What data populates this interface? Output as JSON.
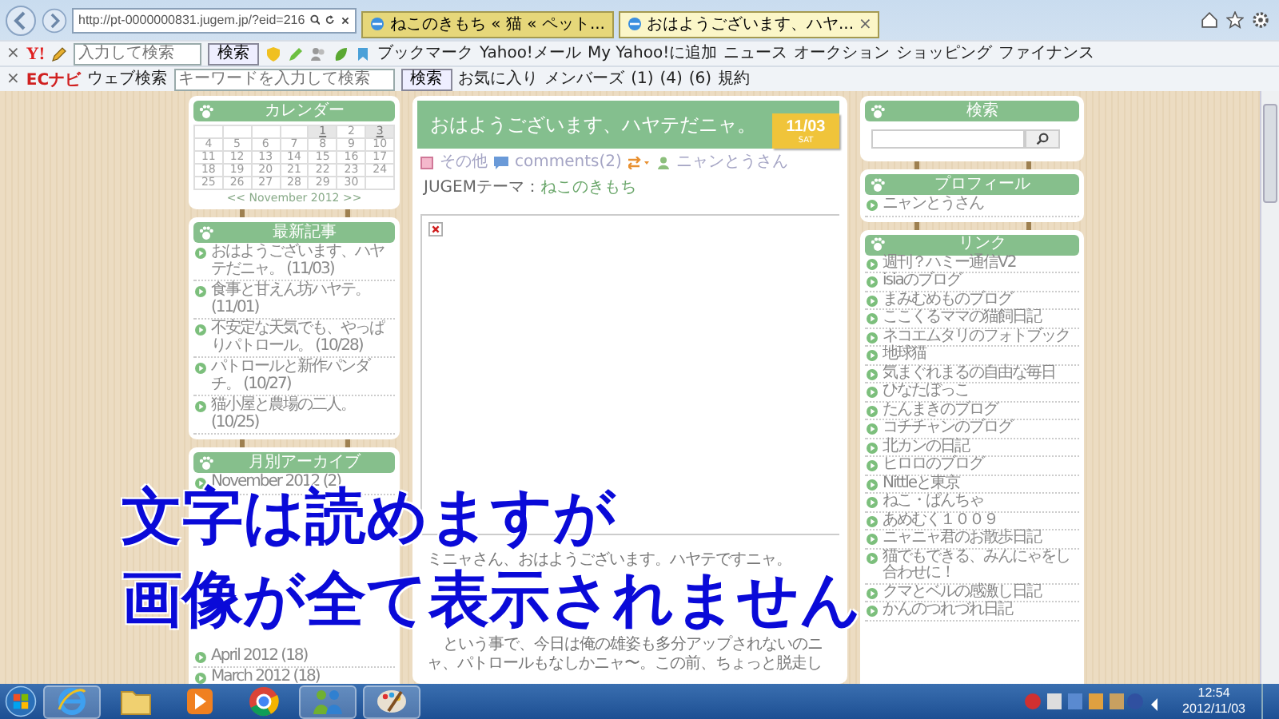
{
  "browser": {
    "address": "http://pt-0000000831.jugem.jp/?eid=216",
    "tab_close": "×",
    "tabs": [
      {
        "label": "ねこのきもち « 猫 « ペット...",
        "selected": false
      },
      {
        "label": "おはようございます、ハヤ...",
        "selected": true
      }
    ]
  },
  "toolbar_1": {
    "close": "×",
    "logo": "Y!",
    "search_placeholder": "入力して検索",
    "search_button": "検索",
    "items": [
      "ブックマーク",
      "Yahoo!メール",
      "My Yahoo!に追加",
      "ニュース",
      "オークション",
      "ショッピング",
      "ファイナンス"
    ]
  },
  "toolbar_2": {
    "close": "×",
    "logo": "ECナビ",
    "web_search": "ウェブ検索",
    "search_placeholder": "キーワードを入力して検索",
    "search_button": "検索",
    "items": [
      "お気に入り",
      "メンバーズ"
    ],
    "counts": [
      "(1)",
      "(4)",
      "(6)"
    ],
    "terms": "規約"
  },
  "calendar": {
    "title": "カレンダー",
    "nav": "<< November 2012 >>",
    "weeks": [
      [
        {
          "day": "1",
          "has_post": true
        },
        {
          "day": "2",
          "has_post": false
        },
        {
          "day": "3",
          "has_post": true
        }
      ],
      [
        {
          "day": "4",
          "has_post": false
        },
        {
          "day": "5",
          "has_post": false
        },
        {
          "day": "6",
          "has_post": false
        },
        {
          "day": "7",
          "has_post": false
        },
        {
          "day": "8",
          "has_post": false
        },
        {
          "day": "9",
          "has_post": false
        },
        {
          "day": "10",
          "has_post": false
        }
      ],
      [
        {
          "day": "11",
          "has_post": false
        },
        {
          "day": "12",
          "has_post": false
        },
        {
          "day": "13",
          "has_post": false
        },
        {
          "day": "14",
          "has_post": false
        },
        {
          "day": "15",
          "has_post": false
        },
        {
          "day": "16",
          "has_post": false
        },
        {
          "day": "17",
          "has_post": false
        }
      ],
      [
        {
          "day": "18",
          "has_post": false
        },
        {
          "day": "19",
          "has_post": false
        },
        {
          "day": "20",
          "has_post": false
        },
        {
          "day": "21",
          "has_post": false
        },
        {
          "day": "22",
          "has_post": false
        },
        {
          "day": "23",
          "has_post": false
        },
        {
          "day": "24",
          "has_post": false
        }
      ],
      [
        {
          "day": "25",
          "has_post": false
        },
        {
          "day": "26",
          "has_post": false
        },
        {
          "day": "27",
          "has_post": false
        },
        {
          "day": "28",
          "has_post": false
        },
        {
          "day": "29",
          "has_post": false
        },
        {
          "day": "30",
          "has_post": false
        }
      ]
    ]
  },
  "recent": {
    "title": "最新記事",
    "items": [
      {
        "title": "おはようございます、ハヤテだニャ。",
        "date": "(11/03)"
      },
      {
        "title": "食事と甘えん坊ハヤテ。",
        "date": "(11/01)"
      },
      {
        "title": "不安定な天気でも、やっぱりパトロール。",
        "date": "(10/28)"
      },
      {
        "title": "パトロールと新作パンダチ。",
        "date": "(10/27)"
      },
      {
        "title": "猫小屋と農場の二人。",
        "date": "(10/25)"
      }
    ]
  },
  "archive": {
    "title": "月別アーカイブ",
    "items": [
      "November 2012 (2)",
      "April 2012 (18)",
      "March 2012 (18)"
    ]
  },
  "post": {
    "title": "おはようございます、ハヤテだニャ。",
    "date": "11/03",
    "weekday": "SAT",
    "category": "その他",
    "comments": "comments(2)",
    "author": "ニャンとうさん",
    "theme_label": "JUGEMテーマ：",
    "theme": "ねこのきもち",
    "paragraphs": [
      "ミニャさん、おはようございます。ハヤテですニャ。",
      "という事で、今日は俺の雄姿も多分アップされないのニャ、パトロールもなしかニャ〜。この前、ちょっと脱走し"
    ]
  },
  "search": {
    "title": "検索"
  },
  "profile": {
    "title": "プロフィール",
    "name": "ニャンとうさん"
  },
  "links": {
    "title": "リンク",
    "items": [
      "週刊？ハミー通信V2",
      "isiaのブログ",
      "まみむめものブログ",
      "ここくるママの猫飼日記",
      "ネコエムタリのフォトブック",
      "地球猫",
      "気まぐれまるの自由な毎日",
      "ひなたぼっこ",
      "たんまきのブログ",
      "コチチャンのブログ",
      "北カンの日記",
      "ヒロロのブログ",
      "Nittleと東京",
      "ねこ・ぱんちゃ",
      "あめむく１００９",
      "ニャニャ君のお散歩日記",
      "猫でもできる、みんにゃをし合わせに！",
      "クマとベルの感激し日記",
      "かんのつれづれ日記"
    ]
  },
  "taskbar": {
    "time": "12:54",
    "date": "2012/11/03"
  },
  "caption": [
    "文字は読めますが",
    "画像が全て表示されません"
  ]
}
